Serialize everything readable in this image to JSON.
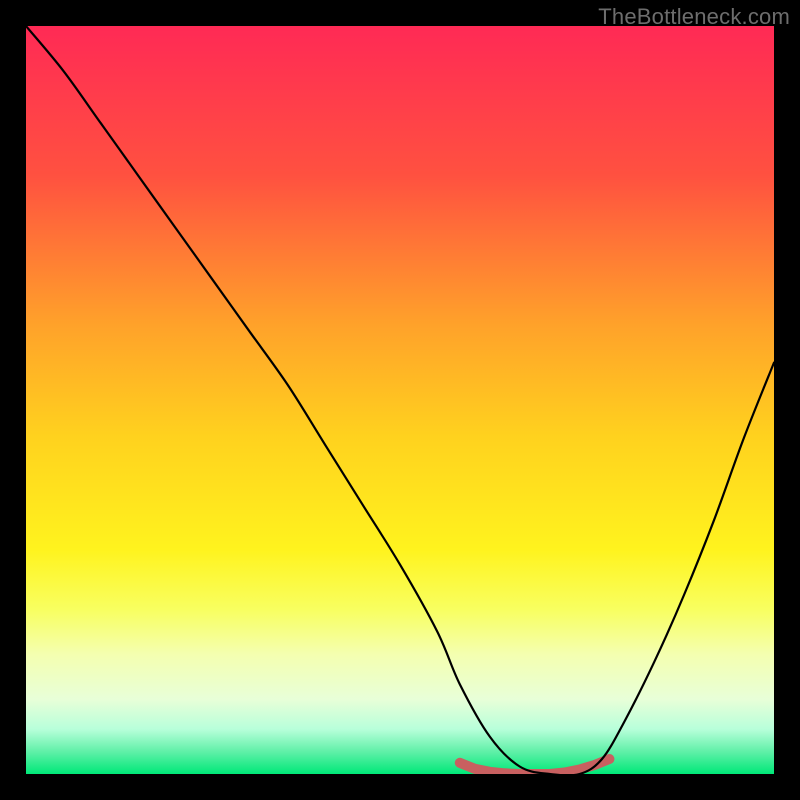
{
  "watermark": "TheBottleneck.com",
  "chart_data": {
    "type": "line",
    "title": "",
    "xlabel": "",
    "ylabel": "",
    "xlim": [
      0,
      100
    ],
    "ylim": [
      0,
      100
    ],
    "background_gradient": {
      "stops": [
        {
          "y": 0,
          "color": "#ff2a55"
        },
        {
          "y": 20,
          "color": "#ff5140"
        },
        {
          "y": 40,
          "color": "#ffa22a"
        },
        {
          "y": 55,
          "color": "#ffd21e"
        },
        {
          "y": 70,
          "color": "#fff31e"
        },
        {
          "y": 78,
          "color": "#f8ff60"
        },
        {
          "y": 84,
          "color": "#f4ffb0"
        },
        {
          "y": 90,
          "color": "#e8ffd8"
        },
        {
          "y": 94,
          "color": "#b8ffda"
        },
        {
          "y": 97,
          "color": "#60f0a8"
        },
        {
          "y": 100,
          "color": "#00e878"
        }
      ]
    },
    "series": [
      {
        "name": "curve",
        "color": "#000000",
        "x": [
          0,
          5,
          10,
          15,
          20,
          25,
          30,
          35,
          40,
          45,
          50,
          55,
          58,
          62,
          66,
          70,
          74,
          77,
          80,
          84,
          88,
          92,
          96,
          100
        ],
        "values": [
          100,
          94,
          87,
          80,
          73,
          66,
          59,
          52,
          44,
          36,
          28,
          19,
          12,
          5,
          1,
          0,
          0,
          2,
          7,
          15,
          24,
          34,
          45,
          55
        ]
      },
      {
        "name": "baseline-marker",
        "color": "#c86060",
        "x": [
          58,
          60,
          62,
          64,
          66,
          68,
          70,
          72,
          74,
          76,
          78
        ],
        "values": [
          1.5,
          0.7,
          0.3,
          0.1,
          0.0,
          0.0,
          0.0,
          0.2,
          0.6,
          1.2,
          2.0
        ]
      }
    ]
  }
}
